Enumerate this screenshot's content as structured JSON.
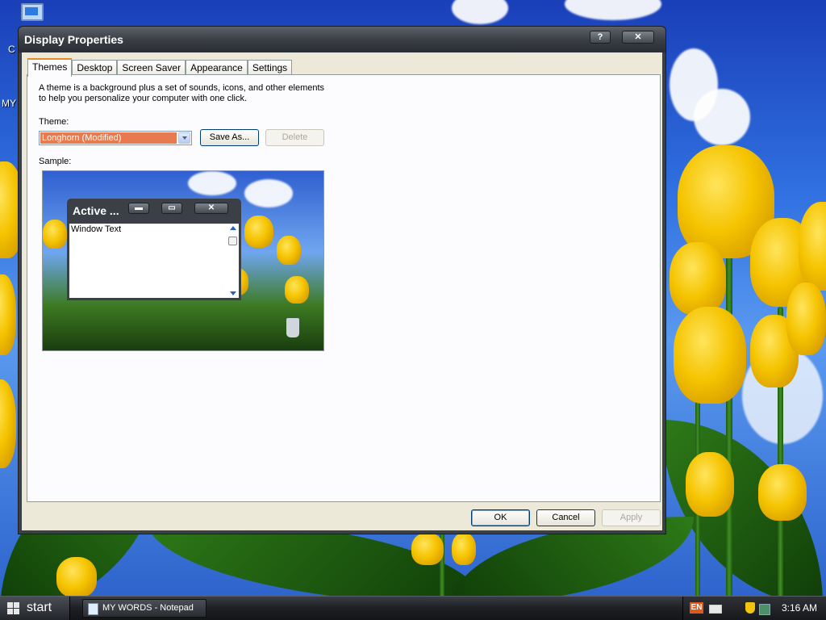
{
  "desktop": {
    "icon_label_partial": "C",
    "text_fragment": "MY"
  },
  "window": {
    "title": "Display Properties",
    "help_glyph": "?",
    "close_glyph": "✕",
    "tabs": [
      {
        "label": "Themes",
        "active": true
      },
      {
        "label": "Desktop",
        "active": false
      },
      {
        "label": "Screen Saver",
        "active": false
      },
      {
        "label": "Appearance",
        "active": false
      },
      {
        "label": "Settings",
        "active": false
      }
    ],
    "themes_tab": {
      "description": "A theme is a background plus a set of sounds, icons, and other elements to help you personalize your computer with one click.",
      "theme_label": "Theme:",
      "theme_value": "Longhorn (Modified)",
      "save_as_label": "Save As...",
      "delete_label": "Delete",
      "sample_label": "Sample:",
      "sample": {
        "window_title": "Active ...",
        "window_text": "Window Text",
        "minimize_glyph": "▬",
        "maximize_glyph": "▭",
        "close_glyph": "✕"
      }
    },
    "buttons": {
      "ok": "OK",
      "cancel": "Cancel",
      "apply": "Apply"
    }
  },
  "taskbar": {
    "start_label": "start",
    "task_button": "MY WORDS - Notepad",
    "language": "EN",
    "clock": "3:16 AM"
  }
}
